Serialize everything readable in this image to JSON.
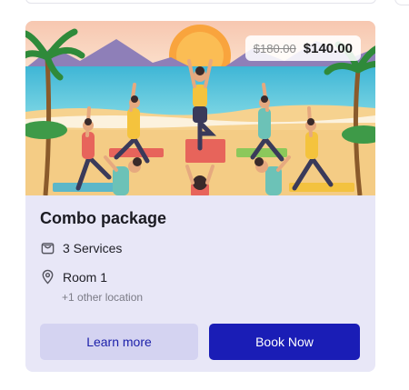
{
  "card": {
    "title": "Combo package",
    "price": {
      "original": "$180.00",
      "current": "$140.00"
    },
    "services": {
      "icon": "shopping-bag-icon",
      "label": "3 Services"
    },
    "location": {
      "icon": "map-pin-icon",
      "label": "Room 1",
      "extra": "+1 other location"
    },
    "buttons": {
      "learn_more": "Learn more",
      "book_now": "Book Now"
    },
    "colors": {
      "card_background": "#e8e7f7",
      "primary_button": "#1a1db6",
      "secondary_button": "#d4d3f1",
      "secondary_button_text": "#1b1fa9"
    }
  }
}
